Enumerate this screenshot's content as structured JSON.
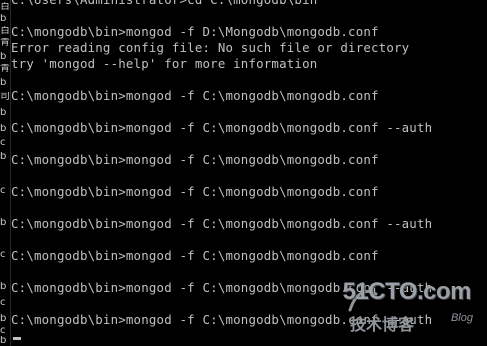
{
  "console": {
    "lines": [
      "C:\\Users\\Administrator>cd C:\\mongodb\\bin",
      "",
      "C:\\mongodb\\bin>mongod -f D:\\Mongodb\\mongodb.conf",
      "Error reading config file: No such file or directory",
      "try 'mongod --help' for more information",
      "",
      "C:\\mongodb\\bin>mongod -f C:\\mongodb\\mongodb.conf",
      "",
      "C:\\mongodb\\bin>mongod -f C:\\mongodb\\mongodb.conf --auth",
      "",
      "C:\\mongodb\\bin>mongod -f C:\\mongodb\\mongodb.conf",
      "",
      "C:\\mongodb\\bin>mongod -f C:\\mongodb\\mongodb.conf",
      "",
      "C:\\mongodb\\bin>mongod -f C:\\mongodb\\mongodb.conf --auth",
      "",
      "C:\\mongodb\\bin>mongod -f C:\\mongodb\\mongodb.conf",
      "",
      "C:\\mongodb\\bin>mongod -f C:\\mongodb\\mongodb.conf --auth",
      "",
      "C:\\mongodb\\bin>mongod -f C:\\mongodb\\mongodb.conf --auth"
    ]
  },
  "left_strip": {
    "glyphs": [
      "百",
      "b",
      "百",
      "青",
      "b",
      "青",
      "b",
      "司",
      "b",
      "b",
      "c",
      "b",
      "c",
      "b",
      "c",
      "b",
      "c",
      "b",
      "c",
      "b"
    ]
  },
  "watermark": {
    "logo": "51CTO.com",
    "subtitle": "技术博客",
    "blog": "Blog"
  },
  "colors": {
    "background": "#000000",
    "text": "#c0c0c0",
    "watermark": "#9aa0a6"
  }
}
